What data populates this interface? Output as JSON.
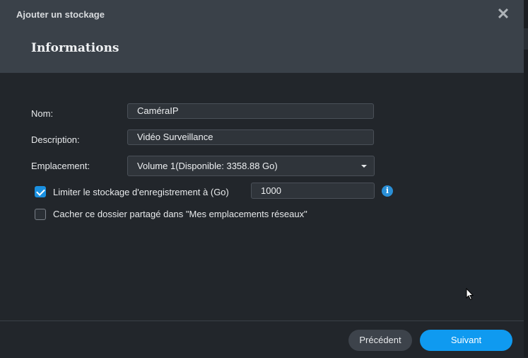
{
  "dialog": {
    "title": "Ajouter un stockage",
    "section_title": "Informations",
    "close_icon": "close-icon"
  },
  "form": {
    "name_label": "Nom:",
    "name_value": "CaméraIP",
    "description_label": "Description:",
    "description_value": "Vidéo Surveillance",
    "location_label": "Emplacement:",
    "location_value": "Volume 1(Disponible: 3358.88 Go)",
    "limit_checkbox_label": "Limiter le stockage d'enregistrement à (Go)",
    "limit_checked": true,
    "limit_value": "1000",
    "info_icon_glyph": "i",
    "hide_checkbox_label": "Cacher ce dossier partagé dans \"Mes emplacements réseaux\"",
    "hide_checked": false
  },
  "footer": {
    "prev_label": "Précédent",
    "next_label": "Suivant"
  },
  "colors": {
    "accent": "#0f9af0",
    "header_bg": "#3a4149",
    "body_bg": "#22262b"
  }
}
